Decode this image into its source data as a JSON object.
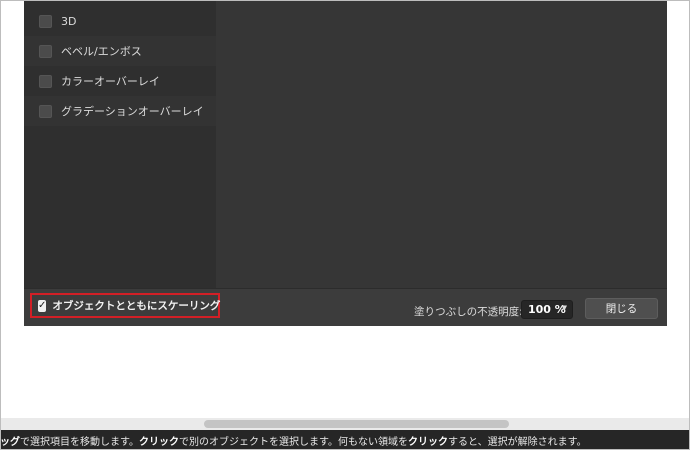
{
  "effects_list": {
    "items": [
      {
        "label": "3D",
        "checked": false
      },
      {
        "label": "ベベル/エンボス",
        "checked": false
      },
      {
        "label": "カラーオーバーレイ",
        "checked": false
      },
      {
        "label": "グラデーションオーバーレイ",
        "checked": false
      }
    ]
  },
  "footer": {
    "scale_with_object_label": "オブジェクトとともにスケーリング",
    "scale_with_object_checked": true,
    "fill_opacity_label": "塗りつぶしの不透明度:",
    "fill_opacity_value": "100 %",
    "close_button_label": "閉じる"
  },
  "status_bar": {
    "part1": "ッグ",
    "part2": " で選択項目を移動します。",
    "part3": "クリック",
    "part4": " で別のオブジェクトを選択します。何もない領域を",
    "part5": "クリック",
    "part6": " すると、選択が解除されます。"
  },
  "colors": {
    "highlight_border": "#d21f26",
    "dialog_bg": "#3a3a3a"
  }
}
